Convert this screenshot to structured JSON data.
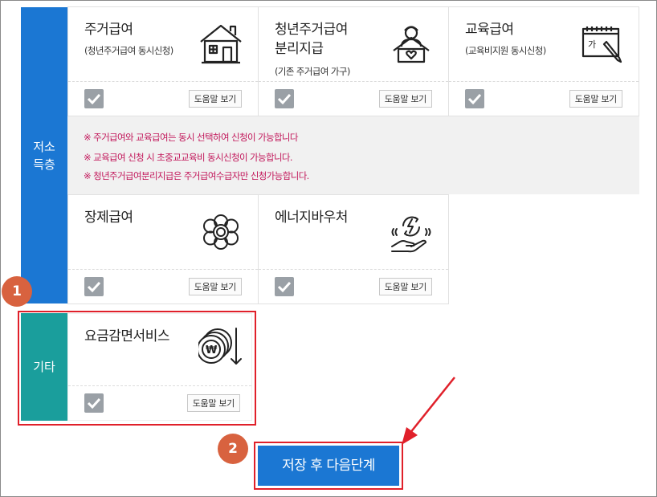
{
  "groups": {
    "low_income_label": "저소\n득층",
    "other_label": "기타"
  },
  "cards": [
    {
      "title": "주거급여",
      "sub": "(청년주거급여 동시신청)",
      "help": "도움말 보기",
      "checked": true,
      "icon": "house-icon"
    },
    {
      "title": "청년주거급여\n분리지급",
      "sub": "(기존 주거급여 가구)",
      "help": "도움말 보기",
      "checked": true,
      "icon": "youth-house-icon"
    },
    {
      "title": "교육급여",
      "sub": "(교육비지원 동시신청)",
      "help": "도움말 보기",
      "checked": true,
      "icon": "notebook-pencil-icon"
    },
    {
      "title": "장제급여",
      "help": "도움말 보기",
      "checked": true,
      "icon": "flower-icon"
    },
    {
      "title": "에너지바우처",
      "help": "도움말 보기",
      "checked": true,
      "icon": "energy-hand-icon"
    },
    {
      "title": "요금감면서비스",
      "help": "도움말 보기",
      "checked": true,
      "icon": "coins-down-icon"
    }
  ],
  "notices": [
    "※ 주거급여와 교육급여는 동시 선택하여 신청이 가능합니다",
    "※ 교육급여 신청 시 초중교교육비 동시신청이 가능합니다.",
    "※ 청년주거급여분리지급은 주거급여수급자만 신청가능합니다."
  ],
  "annotations": {
    "badge1": "1",
    "badge2": "2"
  },
  "save_button": "저장 후 다음단계",
  "colors": {
    "primary": "#1b77d3",
    "teal": "#1a9e9c",
    "notice_text": "#c2185b",
    "highlight": "#e0202a",
    "badge": "#d8623f"
  }
}
